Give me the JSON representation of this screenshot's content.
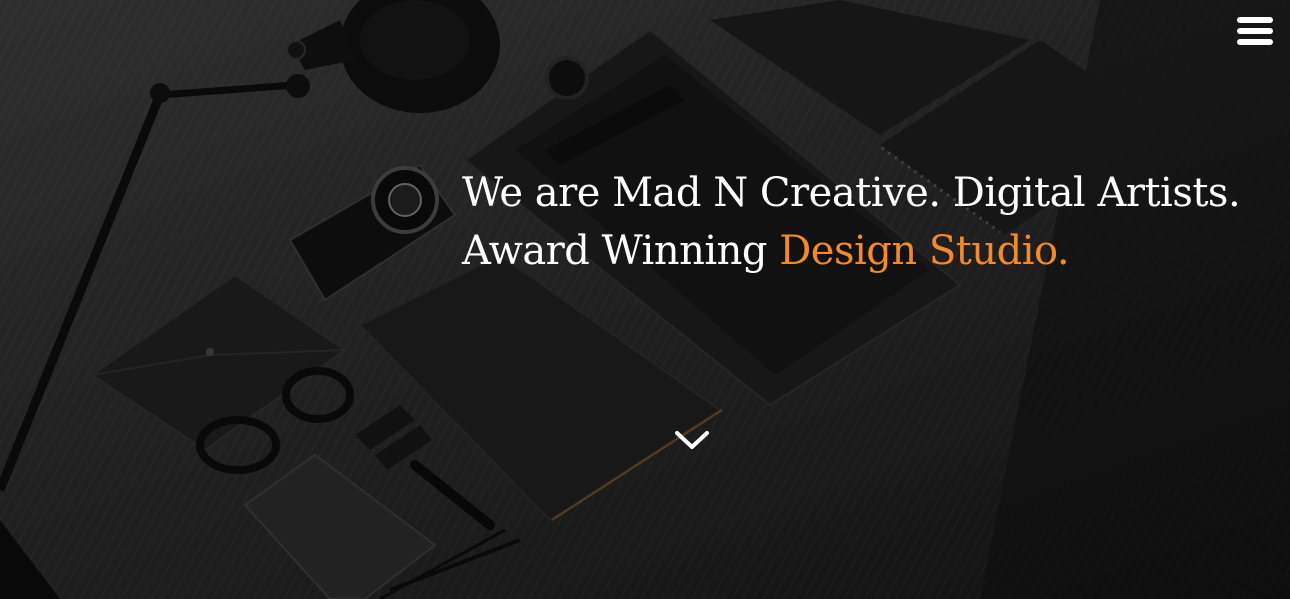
{
  "header": {
    "menu_icon": "hamburger-menu-icon"
  },
  "hero": {
    "line1": "We are Mad N Creative. Digital Artists.",
    "line2_prefix": "Award Winning ",
    "line2_accent": "Design Studio.",
    "scroll_icon": "chevron-down-icon"
  },
  "colors": {
    "accent": "#f28a2d",
    "text": "#ffffff",
    "background": "#2a2a2a"
  }
}
